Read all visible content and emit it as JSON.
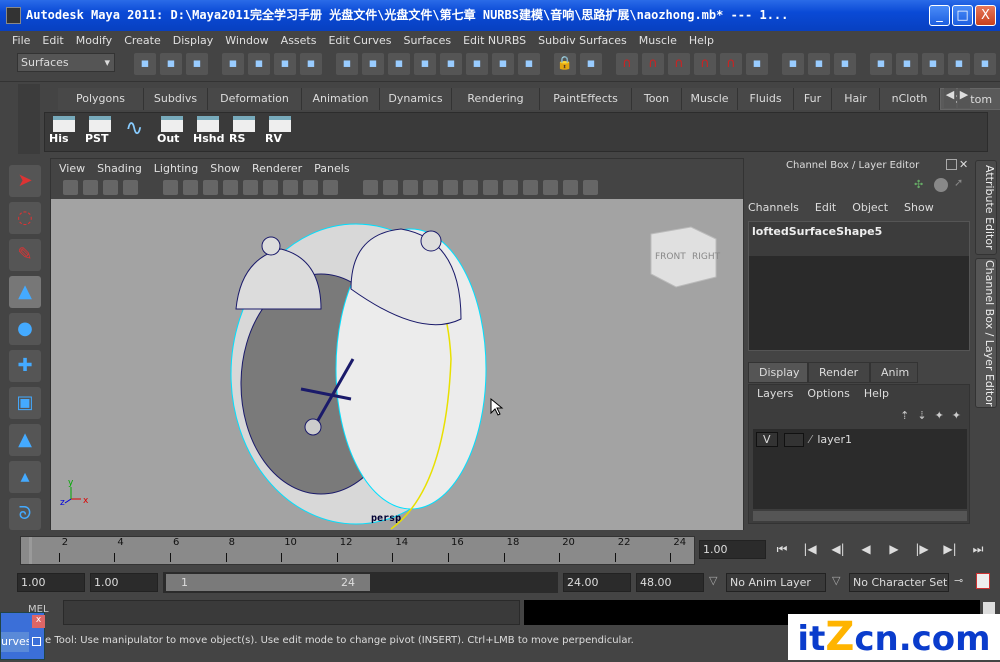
{
  "window": {
    "title": "Autodesk Maya 2011: D:\\Maya2011完全学习手册 光盘文件\\光盘文件\\第七章 NURBS建模\\音响\\思路扩展\\naozhong.mb*    ---    1...",
    "minimize": "_",
    "maximize": "□",
    "close": "X"
  },
  "menubar": [
    "File",
    "Edit",
    "Modify",
    "Create",
    "Display",
    "Window",
    "Assets",
    "Edit Curves",
    "Surfaces",
    "Edit NURBS",
    "Subdiv Surfaces",
    "Muscle",
    "Help"
  ],
  "toolbar": {
    "mode": "Surfaces",
    "icons": [
      "new-scene",
      "open-scene",
      "save-scene",
      "select-hierarchy",
      "select-object",
      "select-component",
      "lock-selection",
      "select-handle",
      "select-joint",
      "select-curve",
      "select-surface",
      "select-deformation",
      "select-dynamics",
      "select-rendering",
      "select-misc",
      "lock",
      "highlight-selection",
      "snap-grid",
      "snap-curve",
      "snap-point",
      "snap-view-plane",
      "make-live",
      "input-ops",
      "output-ops",
      "construction-history",
      "render-view",
      "render-current",
      "ipr-render",
      "render-settings",
      "show-hide-attribute-editor",
      "channel-box-toggle"
    ]
  },
  "shelf": {
    "tabs": [
      "Polygons",
      "Subdivs",
      "Deformation",
      "Animation",
      "Dynamics",
      "Rendering",
      "PaintEffects",
      "Toon",
      "Muscle",
      "Fluids",
      "Fur",
      "Hair",
      "nCloth",
      "Custom"
    ],
    "active_tab": "Custom",
    "items": [
      "His",
      "PST",
      "",
      "Out",
      "Hshd",
      "RS",
      "RV"
    ]
  },
  "toolbox": [
    "select-tool",
    "lasso-tool",
    "paint-select-tool",
    "move-tool",
    "rotate-tool",
    "scale-tool",
    "manipulator-tool",
    "soft-mod-tool",
    "last-tool",
    "show-manipulator"
  ],
  "panel": {
    "menu": [
      "View",
      "Shading",
      "Lighting",
      "Show",
      "Renderer",
      "Panels"
    ],
    "camera_label": "persp",
    "viewcube": {
      "front": "FRONT",
      "right": "RIGHT"
    },
    "axes": {
      "x": "x",
      "y": "y",
      "z": "z"
    }
  },
  "channel_box": {
    "title": "Channel Box / Layer Editor",
    "menu": [
      "Channels",
      "Edit",
      "Object",
      "Show"
    ],
    "selected_node": "loftedSurfaceShape5",
    "layer_tabs": [
      "Display",
      "Render",
      "Anim"
    ],
    "active_layer_tab": "Display",
    "layer_menu": [
      "Layers",
      "Options",
      "Help"
    ],
    "layers": [
      {
        "visible": "V",
        "name": "layer1"
      }
    ]
  },
  "side_tabs": [
    "Attribute Editor",
    "Channel Box / Layer Editor"
  ],
  "timeline": {
    "ticks": [
      "2",
      "4",
      "6",
      "8",
      "10",
      "12",
      "14",
      "16",
      "18",
      "20",
      "22",
      "24"
    ],
    "current_time": "1.00"
  },
  "range": {
    "start": "1.00",
    "playback_start": "1.00",
    "slider_start": "1",
    "slider_end": "24",
    "playback_end": "24.00",
    "end": "48.00",
    "anim_layer": "No Anim Layer",
    "character_set": "No Character Set"
  },
  "command": {
    "label": "MEL",
    "floating_window_label": "urves"
  },
  "help_line": "e Tool: Use manipulator to move object(s). Use edit mode to change pivot (INSERT).  Ctrl+LMB to move perpendicular.",
  "watermark": {
    "a": "it",
    "b": "Z",
    "c": "cn.com"
  }
}
